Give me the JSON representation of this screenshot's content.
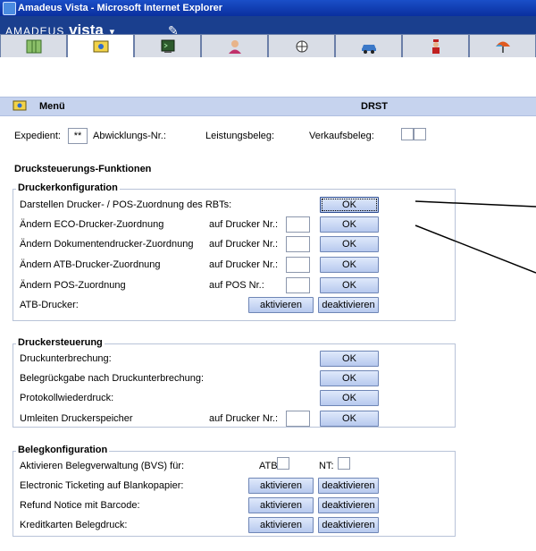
{
  "window": {
    "title": "Amadeus Vista - Microsoft Internet Explorer"
  },
  "brand": {
    "amadeus": "amadeus",
    "vista": "vista",
    "dropdown": "▾"
  },
  "tabs": [
    {
      "icon": "map-icon"
    },
    {
      "icon": "ticket-icon",
      "active": true
    },
    {
      "icon": "terminal-icon"
    },
    {
      "icon": "person-icon"
    },
    {
      "icon": "globe-icon"
    },
    {
      "icon": "car-icon"
    },
    {
      "icon": "bellboy-icon"
    },
    {
      "icon": "umbrella-icon"
    }
  ],
  "menu": {
    "label": "Menü",
    "code": "DRST"
  },
  "header": {
    "expedient_label": "Expedient:",
    "expedient_value": "**",
    "abwicklung_label": "Abwicklungs-Nr.:",
    "leistungsbeleg_label": "Leistungsbeleg:",
    "verkaufsbeleg_label": "Verkaufsbeleg:"
  },
  "section_title": "Drucksteuerungs-Funktionen",
  "printer_config": {
    "legend": "Druckerkonfiguration",
    "rows": [
      {
        "label": "Darstellen Drucker- / POS-Zuordnung des RBTs:",
        "sub": "",
        "button": "OK"
      },
      {
        "label": "Ändern ECO-Drucker-Zuordnung",
        "sub": "auf Drucker Nr.:",
        "button": "OK"
      },
      {
        "label": "Ändern Dokumentendrucker-Zuordnung",
        "sub": "auf Drucker Nr.:",
        "button": "OK"
      },
      {
        "label": "Ändern ATB-Drucker-Zuordnung",
        "sub": "auf Drucker Nr.:",
        "button": "OK"
      },
      {
        "label": "Ändern POS-Zuordnung",
        "sub": "auf POS Nr.:",
        "button": "OK"
      }
    ],
    "atb_label": "ATB-Drucker:",
    "activate": "aktivieren",
    "deactivate": "deaktivieren"
  },
  "printer_control": {
    "legend": "Druckersteuerung",
    "rows": [
      {
        "label": "Druckunterbrechung:",
        "sub": "",
        "button": "OK"
      },
      {
        "label": "Belegrückgabe nach Druckunterbrechung:",
        "sub": "",
        "button": "OK"
      },
      {
        "label": "Protokollwiederdruck:",
        "sub": "",
        "button": "OK"
      },
      {
        "label": "Umleiten Druckerspeicher",
        "sub": "auf Drucker Nr.:",
        "button": "OK"
      }
    ]
  },
  "receipt_config": {
    "legend": "Belegkonfiguration",
    "bvs_label": "Aktivieren Belegverwaltung (BVS) für:",
    "atb": "ATB:",
    "nt": "NT:",
    "rows": [
      {
        "label": "Electronic Ticketing auf Blankopapier:"
      },
      {
        "label": "Refund Notice mit Barcode:"
      },
      {
        "label": "Kreditkarten Belegdruck:"
      }
    ],
    "activate": "aktivieren",
    "deactivate": "deaktivieren"
  }
}
